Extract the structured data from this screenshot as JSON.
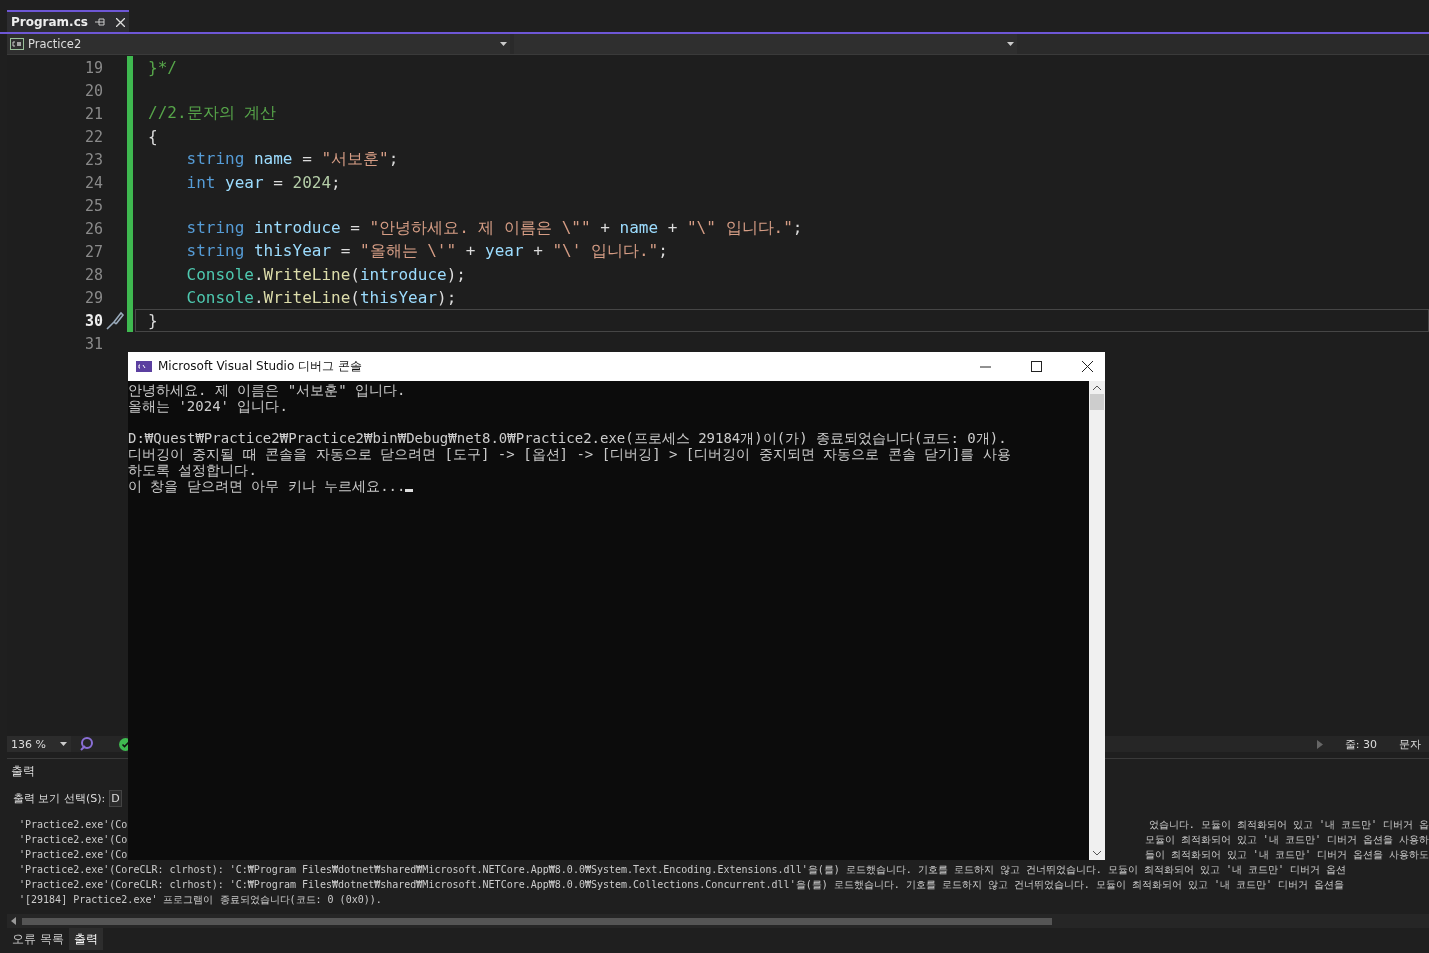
{
  "tabs": [
    {
      "label": "Program.cs",
      "selected": true
    }
  ],
  "nav": {
    "project": "Practice2"
  },
  "editor": {
    "lines": [
      {
        "number": "19",
        "changed": true,
        "current": false,
        "tokens": [
          {
            "text": "}*/",
            "kind": "comment"
          }
        ]
      },
      {
        "number": "20",
        "changed": true,
        "current": false
      },
      {
        "number": "21",
        "changed": true,
        "current": false,
        "tokens": [
          {
            "text": "//2.문자의 계산",
            "kind": "comment"
          }
        ]
      },
      {
        "number": "22",
        "changed": true,
        "current": false,
        "tokens": [
          {
            "text": "{",
            "kind": "plain"
          }
        ]
      },
      {
        "number": "23",
        "changed": true,
        "current": false,
        "tokens": [
          {
            "text": "    string",
            "kind": "keyword"
          },
          {
            "text": " name",
            "kind": "variable"
          },
          {
            "text": " = ",
            "kind": "plain"
          },
          {
            "text": "\"서보훈\"",
            "kind": "string"
          },
          {
            "text": ";",
            "kind": "plain"
          }
        ]
      },
      {
        "number": "24",
        "changed": true,
        "current": false,
        "tokens": [
          {
            "text": "    int",
            "kind": "keyword"
          },
          {
            "text": " year",
            "kind": "variable"
          },
          {
            "text": " = ",
            "kind": "plain"
          },
          {
            "text": "2024",
            "kind": "number"
          },
          {
            "text": ";",
            "kind": "plain"
          }
        ]
      },
      {
        "number": "25",
        "changed": true,
        "current": false
      },
      {
        "number": "26",
        "changed": true,
        "current": false,
        "tokens": [
          {
            "text": "    string",
            "kind": "keyword"
          },
          {
            "text": " introduce",
            "kind": "variable"
          },
          {
            "text": " = ",
            "kind": "plain"
          },
          {
            "text": "\"안녕하세요. 제 이름은 \\\"\"",
            "kind": "string"
          },
          {
            "text": " + ",
            "kind": "plain"
          },
          {
            "text": "name",
            "kind": "variable"
          },
          {
            "text": " + ",
            "kind": "plain"
          },
          {
            "text": "\"\\\" 입니다.\"",
            "kind": "string"
          },
          {
            "text": ";",
            "kind": "plain"
          }
        ]
      },
      {
        "number": "27",
        "changed": true,
        "current": false,
        "tokens": [
          {
            "text": "    string",
            "kind": "keyword"
          },
          {
            "text": " thisYear",
            "kind": "variable"
          },
          {
            "text": " = ",
            "kind": "plain"
          },
          {
            "text": "\"올해는 \\'\"",
            "kind": "string"
          },
          {
            "text": " + ",
            "kind": "plain"
          },
          {
            "text": "year",
            "kind": "variable"
          },
          {
            "text": " + ",
            "kind": "plain"
          },
          {
            "text": "\"\\' 입니다.\"",
            "kind": "string"
          },
          {
            "text": ";",
            "kind": "plain"
          }
        ]
      },
      {
        "number": "28",
        "changed": true,
        "current": false,
        "tokens": [
          {
            "text": "    Console",
            "kind": "type"
          },
          {
            "text": ".",
            "kind": "plain"
          },
          {
            "text": "WriteLine",
            "kind": "method"
          },
          {
            "text": "(",
            "kind": "plain"
          },
          {
            "text": "introduce",
            "kind": "variable"
          },
          {
            "text": ");",
            "kind": "plain"
          }
        ]
      },
      {
        "number": "29",
        "changed": true,
        "current": false,
        "tokens": [
          {
            "text": "    Console",
            "kind": "type"
          },
          {
            "text": ".",
            "kind": "plain"
          },
          {
            "text": "WriteLine",
            "kind": "method"
          },
          {
            "text": "(",
            "kind": "plain"
          },
          {
            "text": "thisYear",
            "kind": "variable"
          },
          {
            "text": ");",
            "kind": "plain"
          }
        ]
      },
      {
        "number": "30",
        "changed": true,
        "current": true,
        "tokens": [
          {
            "text": "}",
            "kind": "plain"
          }
        ]
      },
      {
        "number": "31",
        "changed": false,
        "current": false
      }
    ]
  },
  "status_bar": {
    "zoom": "136 %",
    "line": "줄: 30",
    "column": "문자"
  },
  "output": {
    "title": "출력",
    "select_label": "출력 보기 선택(S):",
    "select_value": "D",
    "lines": [
      {
        "segments": [
          "'Practice2.exe'(Co",
          "었습니다. 모듈이 최적화되어 있고 '내 코드만' 디버거 옵"
        ]
      },
      {
        "segments": [
          "'Practice2.exe'(Co",
          "모듈이 최적화되어 있고 '내 코드만' 디버거 옵션을 사용하"
        ]
      },
      {
        "segments": [
          "'Practice2.exe'(Co",
          "들이 최적화되어 있고 '내 코드만' 디버거 옵션을 사용하도"
        ]
      },
      {
        "segments": [
          "'Practice2.exe'(CoreCLR: clrhost): 'C:₩Program Files₩dotnet₩shared₩Microsoft.NETCore.App₩8.0.0₩System.Text.Encoding.Extensions.dll'을(를) 로드했습니다. 기호를 로드하지 않고 건너뛰었습니다. 모듈이 최적화되어 있고 '내 코드만' 디버거 옵션"
        ]
      },
      {
        "segments": [
          "'Practice2.exe'(CoreCLR: clrhost): 'C:₩Program Files₩dotnet₩shared₩Microsoft.NETCore.App₩8.0.0₩System.Collections.Concurrent.dll'을(를) 로드했습니다. 기호를 로드하지 않고 건너뛰었습니다. 모듈이 최적화되어 있고 '내 코드만' 디버거 옵션을"
        ]
      },
      {
        "segments": [
          "'[29184] Practice2.exe' 프로그램이 종료되었습니다(코드: 0 (0x0))."
        ]
      }
    ]
  },
  "bottom_tabs": [
    {
      "label": "오류 목록",
      "selected": false
    },
    {
      "label": "출력",
      "selected": true
    }
  ],
  "console": {
    "title": "Microsoft Visual Studio 디버그 콘솔",
    "blocks": [
      [
        "안녕하세요. 제 이름은 \"서보훈\" 입니다.",
        "올해는 '2024' 입니다."
      ],
      [
        "D:₩Quest₩Practice2₩Practice2₩bin₩Debug₩net8.0₩Practice2.exe(프로세스 29184개)이(가) 종료되었습니다(코드: 0개).",
        "디버깅이 중지될 때 콘솔을 자동으로 닫으려면 [도구] -> [옵션] -> [디버깅] > [디버깅이 중지되면 자동으로 콘솔 닫기]를 사용",
        "하도록 설정합니다.",
        "이 창을 닫으려면 아무 키나 누르세요..."
      ]
    ]
  }
}
